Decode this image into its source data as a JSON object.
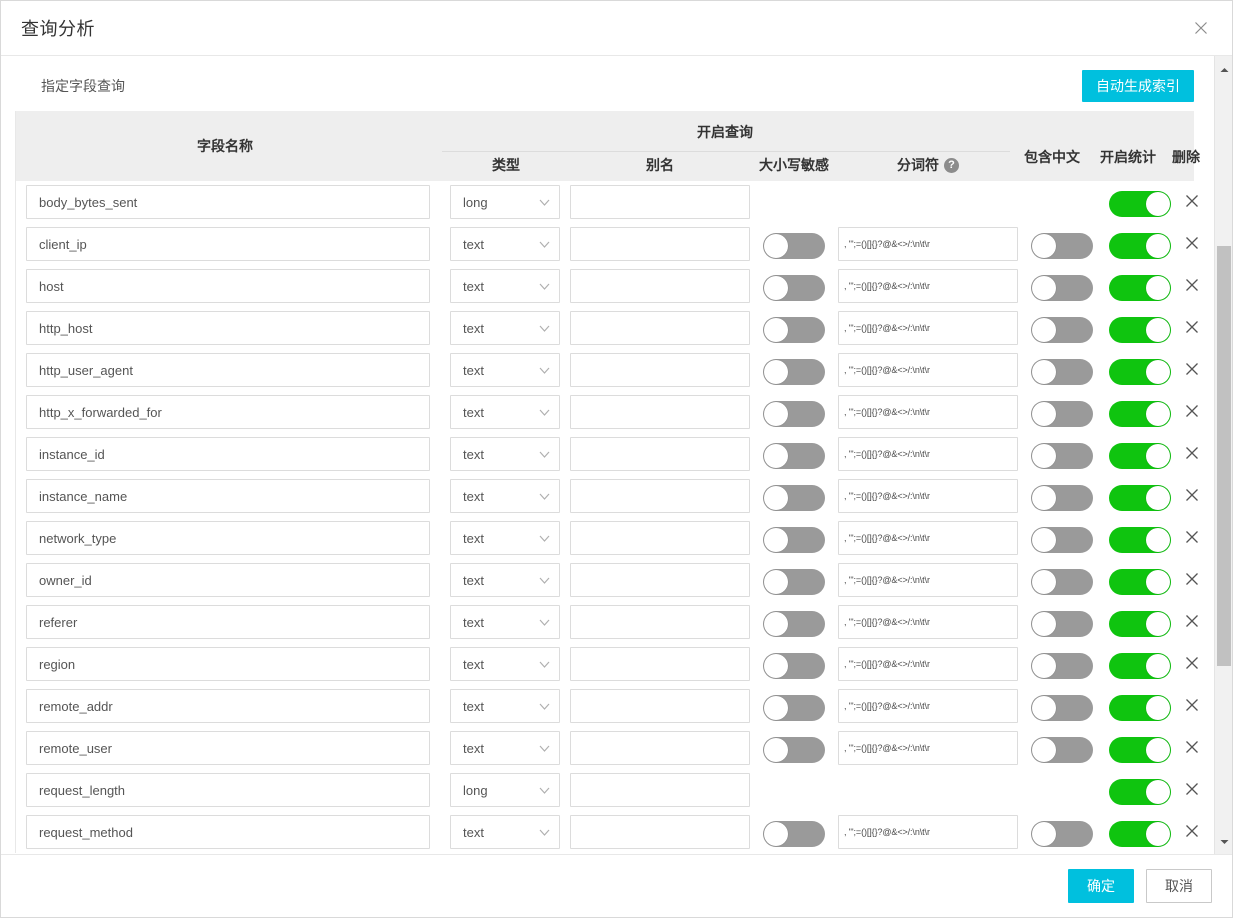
{
  "dialog": {
    "title": "查询分析",
    "close_icon": "close-icon"
  },
  "section": {
    "label": "指定字段查询",
    "generate_index_button": "自动生成索引"
  },
  "table": {
    "headers": {
      "field_name": "字段名称",
      "enable_query_group": "开启查询",
      "type": "类型",
      "alias": "别名",
      "case_sensitive": "大小写敏感",
      "tokenizer": "分词符",
      "tokenizer_help": "?",
      "contains_chinese": "包含中文",
      "enable_statistics": "开启统计",
      "delete": "删除"
    },
    "default_tokenizer": ", '\";=()[]{}?@&<>/:\\n\\t\\r",
    "rows": [
      {
        "field": "body_bytes_sent",
        "type": "long",
        "alias": "",
        "case_sensitive": null,
        "tokenizer": null,
        "contains_chinese": null,
        "statistics": true,
        "delete_icon": "close-icon"
      },
      {
        "field": "client_ip",
        "type": "text",
        "alias": "",
        "case_sensitive": false,
        "tokenizer": ", '\";=()[]{}?@&<>/:\\n\\t\\r",
        "contains_chinese": false,
        "statistics": true,
        "delete_icon": "close-icon"
      },
      {
        "field": "host",
        "type": "text",
        "alias": "",
        "case_sensitive": false,
        "tokenizer": ", '\";=()[]{}?@&<>/:\\n\\t\\r",
        "contains_chinese": false,
        "statistics": true,
        "delete_icon": "close-icon"
      },
      {
        "field": "http_host",
        "type": "text",
        "alias": "",
        "case_sensitive": false,
        "tokenizer": ", '\";=()[]{}?@&<>/:\\n\\t\\r",
        "contains_chinese": false,
        "statistics": true,
        "delete_icon": "close-icon"
      },
      {
        "field": "http_user_agent",
        "type": "text",
        "alias": "",
        "case_sensitive": false,
        "tokenizer": ", '\";=()[]{}?@&<>/:\\n\\t\\r",
        "contains_chinese": false,
        "statistics": true,
        "delete_icon": "close-icon"
      },
      {
        "field": "http_x_forwarded_for",
        "type": "text",
        "alias": "",
        "case_sensitive": false,
        "tokenizer": ", '\";=()[]{}?@&<>/:\\n\\t\\r",
        "contains_chinese": false,
        "statistics": true,
        "delete_icon": "close-icon"
      },
      {
        "field": "instance_id",
        "type": "text",
        "alias": "",
        "case_sensitive": false,
        "tokenizer": ", '\";=()[]{}?@&<>/:\\n\\t\\r",
        "contains_chinese": false,
        "statistics": true,
        "delete_icon": "close-icon"
      },
      {
        "field": "instance_name",
        "type": "text",
        "alias": "",
        "case_sensitive": false,
        "tokenizer": ", '\";=()[]{}?@&<>/:\\n\\t\\r",
        "contains_chinese": false,
        "statistics": true,
        "delete_icon": "close-icon"
      },
      {
        "field": "network_type",
        "type": "text",
        "alias": "",
        "case_sensitive": false,
        "tokenizer": ", '\";=()[]{}?@&<>/:\\n\\t\\r",
        "contains_chinese": false,
        "statistics": true,
        "delete_icon": "close-icon"
      },
      {
        "field": "owner_id",
        "type": "text",
        "alias": "",
        "case_sensitive": false,
        "tokenizer": ", '\";=()[]{}?@&<>/:\\n\\t\\r",
        "contains_chinese": false,
        "statistics": true,
        "delete_icon": "close-icon"
      },
      {
        "field": "referer",
        "type": "text",
        "alias": "",
        "case_sensitive": false,
        "tokenizer": ", '\";=()[]{}?@&<>/:\\n\\t\\r",
        "contains_chinese": false,
        "statistics": true,
        "delete_icon": "close-icon"
      },
      {
        "field": "region",
        "type": "text",
        "alias": "",
        "case_sensitive": false,
        "tokenizer": ", '\";=()[]{}?@&<>/:\\n\\t\\r",
        "contains_chinese": false,
        "statistics": true,
        "delete_icon": "close-icon"
      },
      {
        "field": "remote_addr",
        "type": "text",
        "alias": "",
        "case_sensitive": false,
        "tokenizer": ", '\";=()[]{}?@&<>/:\\n\\t\\r",
        "contains_chinese": false,
        "statistics": true,
        "delete_icon": "close-icon"
      },
      {
        "field": "remote_user",
        "type": "text",
        "alias": "",
        "case_sensitive": false,
        "tokenizer": ", '\";=()[]{}?@&<>/:\\n\\t\\r",
        "contains_chinese": false,
        "statistics": true,
        "delete_icon": "close-icon"
      },
      {
        "field": "request_length",
        "type": "long",
        "alias": "",
        "case_sensitive": null,
        "tokenizer": null,
        "contains_chinese": null,
        "statistics": true,
        "delete_icon": "close-icon"
      },
      {
        "field": "request_method",
        "type": "text",
        "alias": "",
        "case_sensitive": false,
        "tokenizer": ", '\";=()[]{}?@&<>/:\\n\\t\\r",
        "contains_chinese": false,
        "statistics": true,
        "delete_icon": "close-icon"
      }
    ]
  },
  "scrollbar": {
    "up_icon": "chevron-up-icon",
    "down_icon": "chevron-down-icon"
  },
  "footer": {
    "confirm": "确定",
    "cancel": "取消"
  },
  "colors": {
    "accent": "#00c0de",
    "toggle_on": "#0fc40f",
    "toggle_off": "#9a9a9a",
    "header_bg": "#eeeeee"
  }
}
